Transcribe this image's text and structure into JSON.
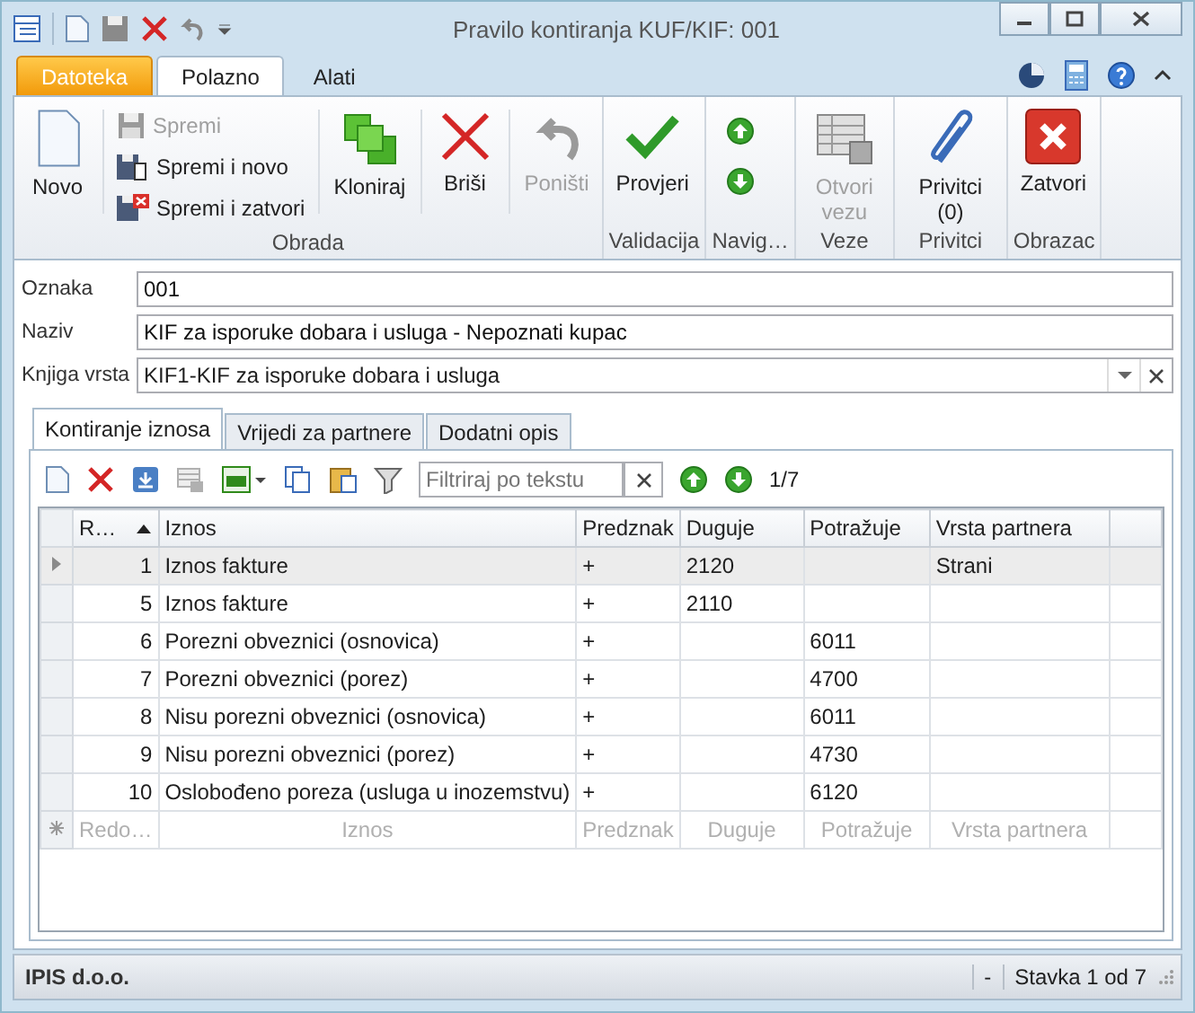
{
  "window": {
    "title": "Pravilo kontiranja KUF/KIF: 001"
  },
  "ribbon_tabs": [
    {
      "label": "Datoteka",
      "kind": "file",
      "selected": false
    },
    {
      "label": "Polazno",
      "kind": "tab",
      "selected": true
    },
    {
      "label": "Alati",
      "kind": "tab",
      "selected": false
    }
  ],
  "ribbon_groups": [
    {
      "label": "Obrada",
      "buttons": [
        {
          "label": "Novo",
          "kind": "large",
          "disabled": false
        },
        {
          "kind": "stack",
          "items": [
            {
              "label": "Spremi",
              "disabled": true
            },
            {
              "label": "Spremi i novo",
              "disabled": false
            },
            {
              "label": "Spremi i zatvori",
              "disabled": false
            }
          ]
        },
        {
          "label": "Kloniraj",
          "kind": "large",
          "disabled": false
        },
        {
          "label": "Briši",
          "kind": "large",
          "disabled": false
        },
        {
          "label": "Poništi",
          "kind": "large",
          "disabled": true
        }
      ]
    },
    {
      "label": "Validacija",
      "buttons": [
        {
          "label": "Provjeri",
          "kind": "large",
          "disabled": false
        }
      ]
    },
    {
      "label": "Navig…",
      "buttons": [
        {
          "kind": "arrows"
        }
      ]
    },
    {
      "label": "Veze",
      "buttons": [
        {
          "label": "Otvori vezu",
          "kind": "large",
          "disabled": true
        }
      ]
    },
    {
      "label": "Privitci",
      "buttons": [
        {
          "label": "Privitci (0)",
          "kind": "large",
          "disabled": false
        }
      ]
    },
    {
      "label": "Obrazac",
      "buttons": [
        {
          "label": "Zatvori",
          "kind": "large",
          "disabled": false
        }
      ]
    }
  ],
  "fields": [
    {
      "label": "Oznaka",
      "value": "001",
      "kind": "text"
    },
    {
      "label": "Naziv",
      "value": "KIF za isporuke dobara i usluga - Nepoznati kupac",
      "kind": "text"
    },
    {
      "label": "Knjiga vrsta",
      "value": "KIF1-KIF za isporuke dobara i usluga",
      "kind": "lookup"
    }
  ],
  "tabs": [
    {
      "label": "Kontiranje iznosa",
      "selected": true
    },
    {
      "label": "Vrijedi za partnere",
      "selected": false
    },
    {
      "label": "Dodatni opis",
      "selected": false
    }
  ],
  "grid_toolbar": {
    "filter": {
      "placeholder": "Filtriraj po tekstu"
    },
    "counter": "1/7",
    "copy_disabled": true
  },
  "table": {
    "columns": [
      {
        "label": "R…",
        "sorted": true
      },
      {
        "label": "Iznos",
        "sorted": false
      },
      {
        "label": "Predznak",
        "sorted": false
      },
      {
        "label": "Duguje",
        "sorted": false
      },
      {
        "label": "Potražuje",
        "sorted": false
      },
      {
        "label": "Vrsta partnera",
        "sorted": false
      }
    ],
    "rows": [
      {
        "cells": [
          "1",
          "Iznos fakture",
          "+",
          "2120",
          "",
          "Strani"
        ],
        "selected": true
      },
      {
        "cells": [
          "5",
          "Iznos fakture",
          "+",
          "2110",
          "",
          ""
        ],
        "selected": false
      },
      {
        "cells": [
          "6",
          "Porezni obveznici (osnovica)",
          "+",
          "",
          "6011",
          ""
        ],
        "selected": false
      },
      {
        "cells": [
          "7",
          "Porezni obveznici (porez)",
          "+",
          "",
          "4700",
          ""
        ],
        "selected": false
      },
      {
        "cells": [
          "8",
          "Nisu porezni obveznici (osnovica)",
          "+",
          "",
          "6011",
          ""
        ],
        "selected": false
      },
      {
        "cells": [
          "9",
          "Nisu porezni obveznici (porez)",
          "+",
          "",
          "4730",
          ""
        ],
        "selected": false
      },
      {
        "cells": [
          "10",
          "Oslobođeno poreza (usluga u inozemstvu)",
          "+",
          "",
          "6120",
          ""
        ],
        "selected": false
      }
    ],
    "new_row": [
      "Redo…",
      "Iznos",
      "Predznak",
      "Duguje",
      "Potražuje",
      "Vrsta partnera"
    ]
  },
  "status_bar": {
    "company": "IPIS d.o.o.",
    "separator": "-",
    "position": "Stavka 1 od 7"
  }
}
